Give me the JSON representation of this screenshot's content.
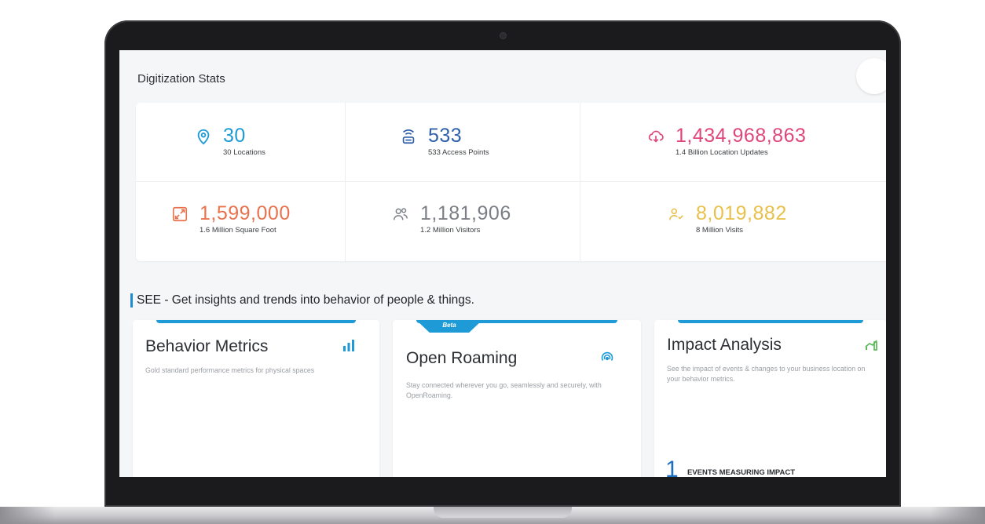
{
  "page": {
    "title": "Digitization Stats"
  },
  "stats": [
    {
      "icon": "location-pin-icon",
      "value": "30",
      "label": "30 Locations",
      "color": "#1e9ad6"
    },
    {
      "icon": "access-point-icon",
      "value": "533",
      "label": "533 Access Points",
      "color": "#2e5fa8"
    },
    {
      "icon": "cloud-update-icon",
      "value": "1,434,968,863",
      "label": "1.4 Billion Location Updates",
      "color": "#e0457b"
    },
    {
      "icon": "expand-area-icon",
      "value": "1,599,000",
      "label": "1.6 Million Square Foot",
      "color": "#e9724c"
    },
    {
      "icon": "visitors-icon",
      "value": "1,181,906",
      "label": "1.2 Million Visitors",
      "color": "#7b7f85"
    },
    {
      "icon": "visits-icon",
      "value": "8,019,882",
      "label": "8 Million Visits",
      "color": "#e9c04a"
    }
  ],
  "see": {
    "title": "SEE - Get insights and trends into behavior of people & things."
  },
  "cards": [
    {
      "title": "Behavior Metrics",
      "description": "Gold standard performance metrics for physical spaces",
      "icon": "bar-chart-icon"
    },
    {
      "badge": "Beta",
      "title": "Open Roaming",
      "description": "Stay connected wherever you go, seamlessly and securely, with OpenRoaming.",
      "icon": "roaming-signal-icon"
    },
    {
      "title": "Impact Analysis",
      "description": "See the impact of events & changes to your business location on your behavior metrics.",
      "icon": "impact-chart-icon",
      "metric_value": "1",
      "metric_label": "EVENTS MEASURING IMPACT"
    }
  ],
  "colors": {
    "accent": "#1e9ad6",
    "locations": "#1e9ad6",
    "access_points": "#2e5fa8",
    "location_updates": "#e0457b",
    "square_foot": "#e9724c",
    "visitors": "#7b7f85",
    "visits": "#e9c04a"
  }
}
